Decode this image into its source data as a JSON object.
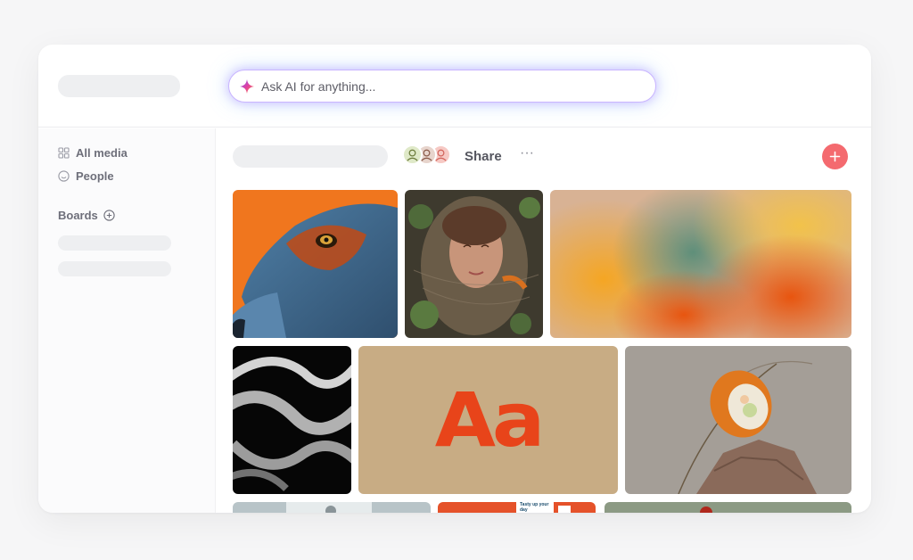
{
  "search": {
    "placeholder": "Ask AI for anything...",
    "icon": "sparkle-icon"
  },
  "sidebar": {
    "items": [
      {
        "label": "All media",
        "icon": "grid-icon"
      },
      {
        "label": "People",
        "icon": "smiley-icon"
      }
    ],
    "boards_label": "Boards"
  },
  "toolbar": {
    "share_label": "Share",
    "more_label": "···",
    "add_label": "+"
  },
  "gallery": {
    "aa_text": "Aa",
    "promo_text": "Tasty up your day"
  },
  "colors": {
    "accent": "#f46a6f",
    "ai_glow": "#b48cff",
    "aa_red": "#e8441a",
    "aa_bg": "#c8ac84"
  }
}
